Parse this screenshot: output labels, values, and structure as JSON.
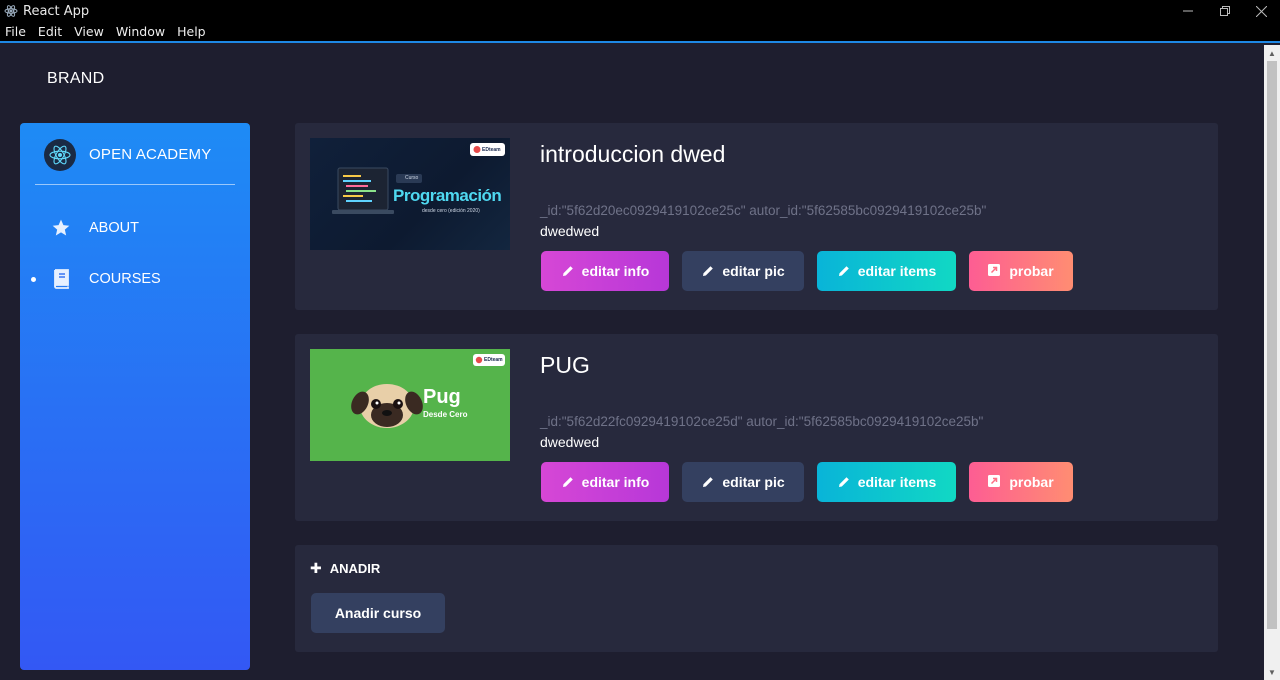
{
  "window": {
    "title": "React App",
    "controls": [
      "minimize-icon",
      "restore-icon",
      "close-icon"
    ]
  },
  "menubar": {
    "items": [
      "File",
      "Edit",
      "View",
      "Window",
      "Help"
    ]
  },
  "brand": "BRAND",
  "sidebar": {
    "title": "OPEN ACADEMY",
    "logo_icon": "react-icon",
    "items": [
      {
        "label": "ABOUT",
        "icon": "star-icon",
        "active": false
      },
      {
        "label": "COURSES",
        "icon": "book-icon",
        "active": true
      }
    ],
    "gradient_top": "#1e8bf5",
    "gradient_bottom": "#3358f4"
  },
  "courses": [
    {
      "title": "introduccion dwed",
      "ids": "_id:\"5f62d20ec0929419102ce25c\" autor_id:\"5f62585bc0929419102ce25b\"",
      "description": "dwedwed",
      "thumbnail": {
        "badge": "EDteam",
        "tag": "Curso",
        "heading": "Programación",
        "subheading": "desde cero (edición 2020)"
      },
      "buttons": {
        "info": "editar info",
        "pic": "editar pic",
        "items": "editar items",
        "probar": "probar"
      }
    },
    {
      "title": "PUG",
      "ids": "_id:\"5f62d22fc0929419102ce25d\" autor_id:\"5f62585bc0929419102ce25b\"",
      "description": "dwedwed",
      "thumbnail": {
        "badge": "EDteam",
        "heading": "Pug",
        "subheading": "Desde Cero"
      },
      "buttons": {
        "info": "editar info",
        "pic": "editar pic",
        "items": "editar items",
        "probar": "probar"
      }
    }
  ],
  "add_section": {
    "header": "ANADIR",
    "button": "Anadir curso"
  },
  "colors": {
    "background": "#1e1e2f",
    "card": "#27293d",
    "btn_info": "#d647d6",
    "btn_pic": "#344060",
    "btn_items": "#09b4d8",
    "btn_probar": "#fd5d93",
    "accent_line": "#1e88e5"
  }
}
